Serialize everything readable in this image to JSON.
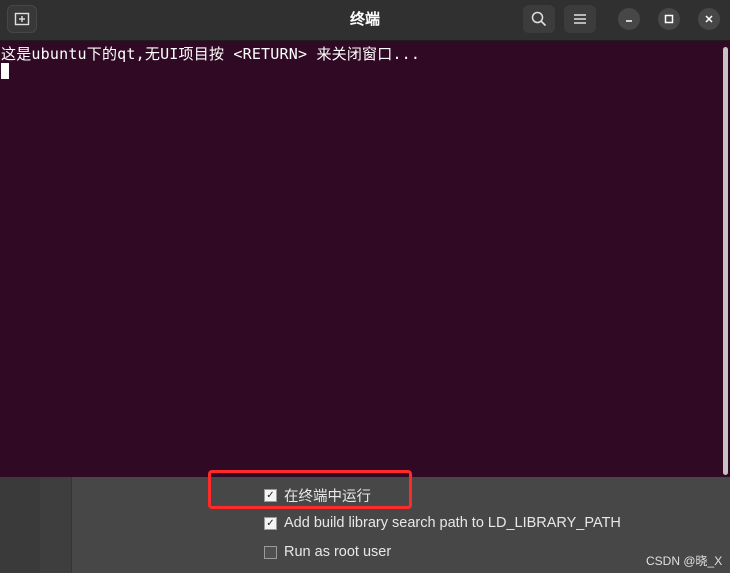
{
  "window": {
    "title": "终端",
    "icons": {
      "new_tab": "new-tab-icon",
      "search": "search-icon",
      "menu": "hamburger-menu-icon",
      "minimize": "minimize-icon",
      "maximize": "maximize-icon",
      "close": "close-icon"
    }
  },
  "terminal": {
    "output_line": "这是ubuntu下的qt,无UI项目按 <RETURN> 来关闭窗口...",
    "background_color": "#300a24",
    "text_color": "#ffffff"
  },
  "run_settings": {
    "options": [
      {
        "label": "在终端中运行",
        "checked": true
      },
      {
        "label": "Add build library search path to LD_LIBRARY_PATH",
        "checked": true
      },
      {
        "label": "Run as root user",
        "checked": false
      }
    ]
  },
  "annotation": {
    "highlight_color": "#ff2a2a"
  },
  "watermark": "CSDN @晓_X"
}
